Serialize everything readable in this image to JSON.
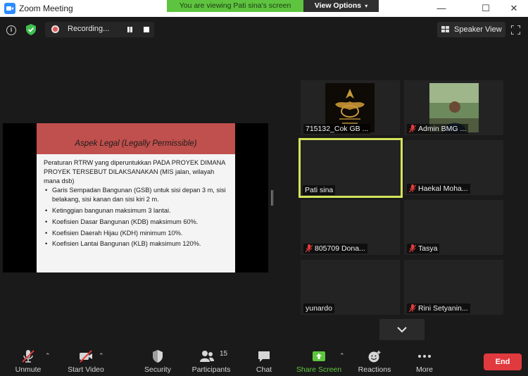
{
  "window": {
    "title": "Zoom Meeting",
    "minimize_icon": "minimize-icon",
    "maximize_icon": "maximize-icon",
    "close_icon": "close-icon"
  },
  "banner": {
    "viewing_text": "You are viewing Pati sina's screen",
    "view_options_label": "View Options"
  },
  "top_bar": {
    "recording_label": "Recording...",
    "speaker_view_label": "Speaker View"
  },
  "slide": {
    "title": "Aspek Legal (Legally Permissible)",
    "intro": "Peraturan RTRW yang diperuntukkan PADA PROYEK DIMANA PROYEK TERSEBUT DILAKSANAKAN (MIS jalan, wilayah mana dsb)",
    "bullets": [
      "Garis Sempadan Bangunan (GSB) untuk sisi depan 3 m, sisi belakang, sisi kanan dan sisi kiri 2 m.",
      "Ketinggian bangunan maksimum 3 lantai.",
      "Koefisien Dasar Bangunan (KDB) maksimum 60%.",
      "Koefisien Daerah Hijau (KDH) minimum 10%.",
      "Koefisien Lantai Bangunan (KLB) maksimum 120%."
    ]
  },
  "participants": [
    {
      "name": "715132_Cok GB ...",
      "muted": false
    },
    {
      "name": "Admin BMG ...",
      "muted": true
    },
    {
      "name": "Pati sina",
      "muted": false,
      "active": true
    },
    {
      "name": "Haekal Moha...",
      "muted": true
    },
    {
      "name": "805709 Dona...",
      "muted": true
    },
    {
      "name": "Tasya",
      "muted": true
    },
    {
      "name": "yunardo",
      "muted": false
    },
    {
      "name": "Rini Setyanin...",
      "muted": true
    }
  ],
  "toolbar": {
    "unmute_label": "Unmute",
    "start_video_label": "Start Video",
    "security_label": "Security",
    "participants_label": "Participants",
    "participants_count": "15",
    "chat_label": "Chat",
    "share_screen_label": "Share Screen",
    "reactions_label": "Reactions",
    "more_label": "More",
    "end_label": "End"
  },
  "colors": {
    "share_green": "#5ec43f",
    "active_speaker": "#d4e35a",
    "end_red": "#e0393e",
    "slide_header": "#c0504d",
    "mute_red": "#e23c3c"
  }
}
